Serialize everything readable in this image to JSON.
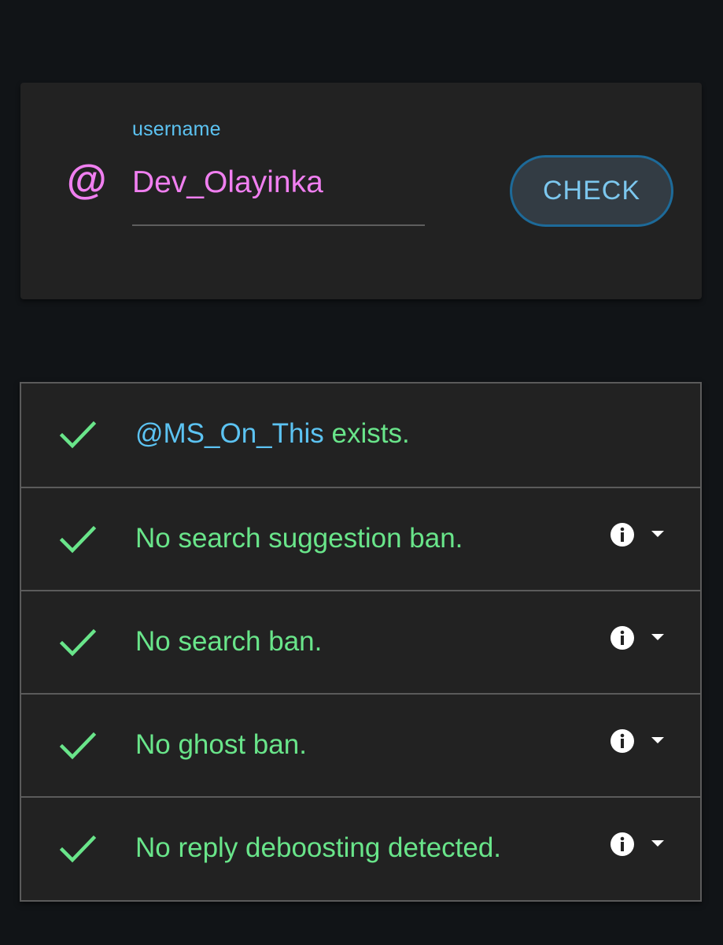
{
  "search": {
    "label": "username",
    "value": "Dev_Olayinka",
    "prefix_icon": "at-icon",
    "button_label": "CHECK"
  },
  "results": {
    "rows": [
      {
        "handle": "@MS_On_This",
        "text": " exists.",
        "status_icon": "checkmark-icon",
        "has_info": false
      },
      {
        "text": "No search suggestion ban.",
        "status_icon": "checkmark-icon",
        "has_info": true
      },
      {
        "text": "No search ban.",
        "status_icon": "checkmark-icon",
        "has_info": true
      },
      {
        "text": "No ghost ban.",
        "status_icon": "checkmark-icon",
        "has_info": true
      },
      {
        "text": "No reply deboosting detected.",
        "status_icon": "checkmark-icon",
        "has_info": true
      }
    ]
  },
  "colors": {
    "background": "#111417",
    "card": "#222222",
    "accent_pink": "#f07ff0",
    "accent_blue": "#5cc3f2",
    "success_green": "#69e58a"
  }
}
